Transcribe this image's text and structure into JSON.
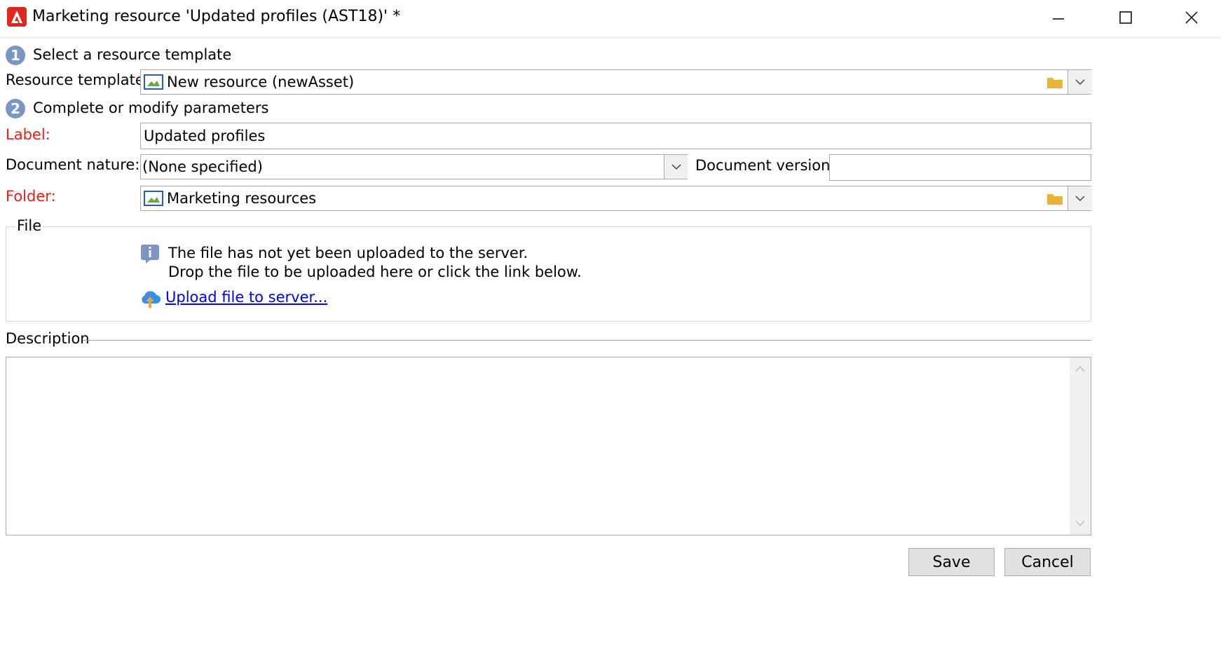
{
  "window": {
    "title": "Marketing resource 'Updated profiles (AST18)' *",
    "icon": "adobe-app-icon"
  },
  "step1": {
    "number": "1",
    "label": "Select a resource template"
  },
  "step2": {
    "number": "2",
    "label": "Complete or modify parameters"
  },
  "form": {
    "resource_template_label": "Resource template:",
    "resource_template_value": "New resource (newAsset)",
    "label_label": "Label:",
    "label_value": "Updated profiles",
    "document_nature_label": "Document nature:",
    "document_nature_value": "(None specified)",
    "document_version_label": "Document version:",
    "document_version_value": "",
    "folder_label": "Folder:",
    "folder_value": "Marketing resources"
  },
  "file": {
    "group_title": "File",
    "info_line1": "The file has not yet been uploaded to the server.",
    "info_line2": "Drop the file to be uploaded here or click the link below.",
    "upload_link": "Upload file to server..."
  },
  "description": {
    "title": "Description",
    "value": ""
  },
  "buttons": {
    "save": "Save",
    "cancel": "Cancel"
  },
  "colors": {
    "required_label": "#e0241b",
    "step_badge": "#7b96c4",
    "link": "#0000ee",
    "folder": "#e8b339"
  }
}
